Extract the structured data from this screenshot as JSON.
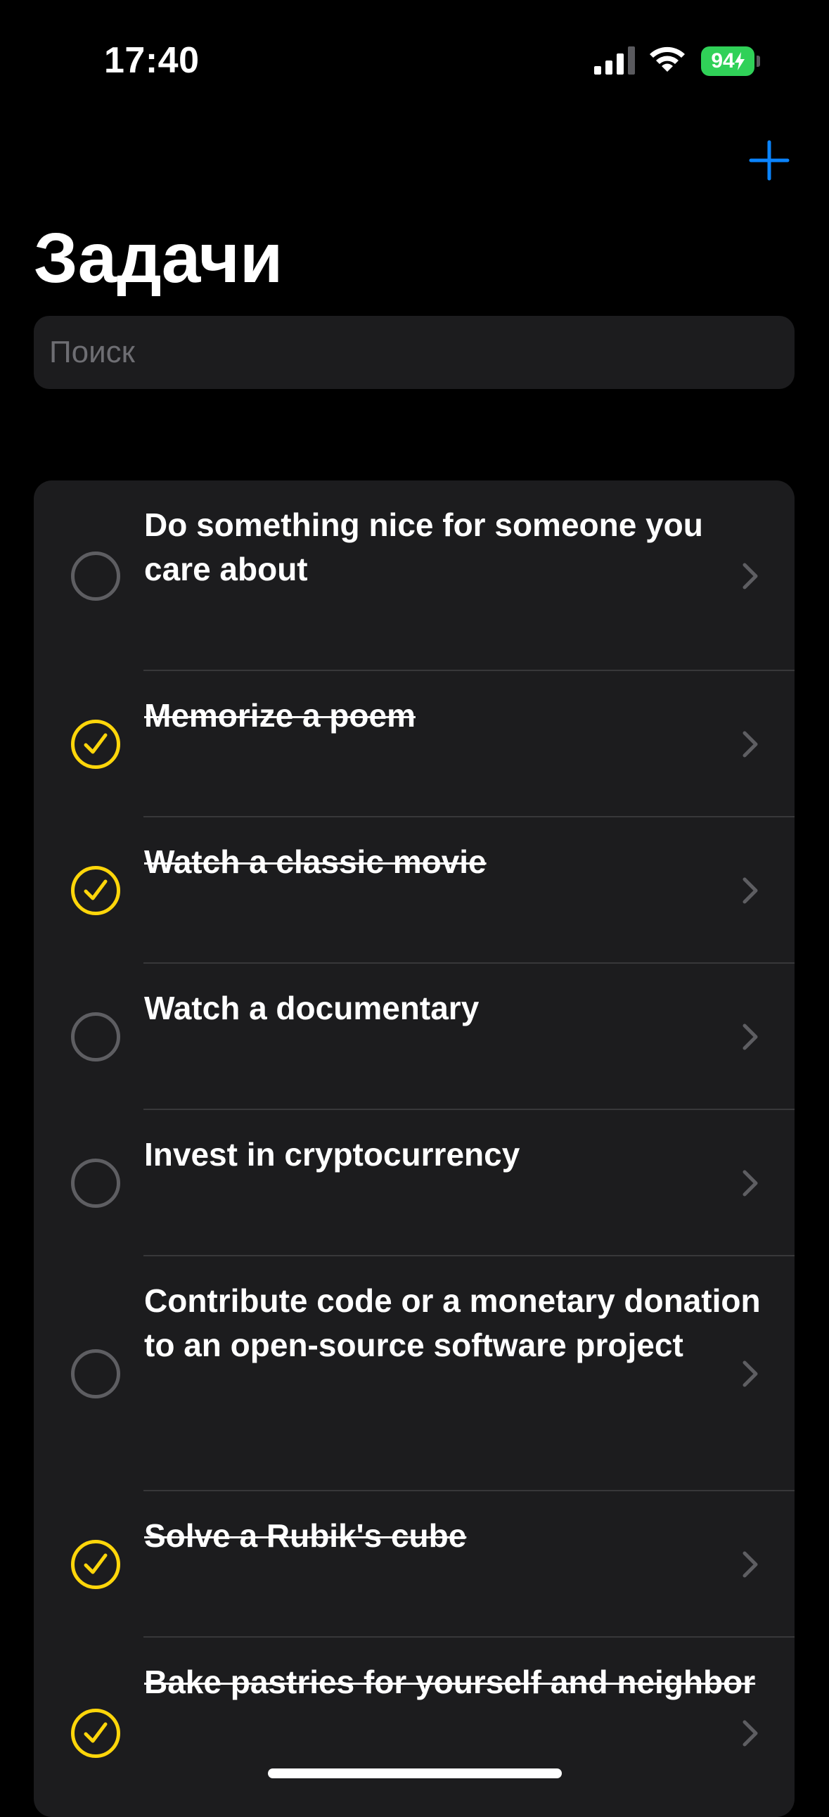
{
  "status_bar": {
    "time": "17:40",
    "battery": "94"
  },
  "nav": {
    "add_icon": "plus-icon",
    "title": "Задачи"
  },
  "search": {
    "placeholder": "Поиск",
    "value": ""
  },
  "colors": {
    "accent": "#0a84ff",
    "done_check": "#ffd60a",
    "battery": "#30d158"
  },
  "tasks": [
    {
      "title": "Do something nice for someone you care about",
      "completed": false
    },
    {
      "title": "Memorize a poem",
      "completed": true
    },
    {
      "title": "Watch a classic movie",
      "completed": true
    },
    {
      "title": "Watch a documentary",
      "completed": false
    },
    {
      "title": "Invest in cryptocurrency",
      "completed": false
    },
    {
      "title": "Contribute code or a monetary donation to an open-source software project",
      "completed": false
    },
    {
      "title": "Solve a Rubik's cube",
      "completed": true
    },
    {
      "title": "Bake pastries for yourself and neighbor",
      "completed": true
    }
  ]
}
